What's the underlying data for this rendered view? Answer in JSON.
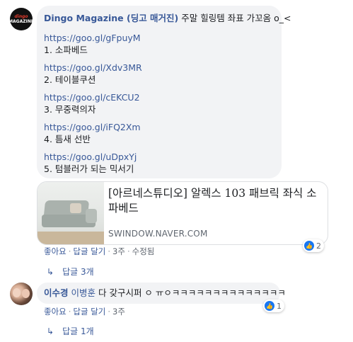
{
  "comment1": {
    "author": "Dingo Magazine (딩고 매거진)",
    "text": " 주말 힐링템 좌표 가꼬옴 o_<",
    "avatar": {
      "top": "dingo",
      "bottom": "MAGAZINE"
    },
    "items": [
      {
        "url": "https://goo.gl/gFpuyM",
        "label": "1. 소파베드"
      },
      {
        "url": "https://goo.gl/Xdv3MR",
        "label": "2. 테이블쿠션"
      },
      {
        "url": "https://goo.gl/cEKCU2",
        "label": "3. 무중력의자"
      },
      {
        "url": "https://goo.gl/iFQ2Xm",
        "label": "4. 틈새 선반"
      },
      {
        "url": "https://goo.gl/uDpxYj",
        "label": "5. 텀블러가 되는 믹서기"
      }
    ],
    "preview": {
      "title": "[아르네스튜디오] 알렉스 103 패브릭 좌식 소파베드",
      "domain": "SWINDOW.NAVER.COM"
    },
    "actions": {
      "like": "좋아요",
      "reply": "답글 달기",
      "time": "3주",
      "edited": "수정됨"
    },
    "reaction_count": "2",
    "replies_link": "답글 3개"
  },
  "comment2": {
    "author": "이수경",
    "tagged": "이병훈",
    "text": " 다 갖구시퍼 ㅇ ㅠㅇㅋㅋㅋㅋㅋㅋㅋㅋㅋㅋㅋㅋㅋㅋ",
    "actions": {
      "like": "좋아요",
      "reply": "답글 달기",
      "time": "3주"
    },
    "reaction_count": "1",
    "replies_link": "답글 1개"
  },
  "colors": {
    "link": "#385898",
    "bubble": "#f2f3f5",
    "like": "#1877f2"
  }
}
